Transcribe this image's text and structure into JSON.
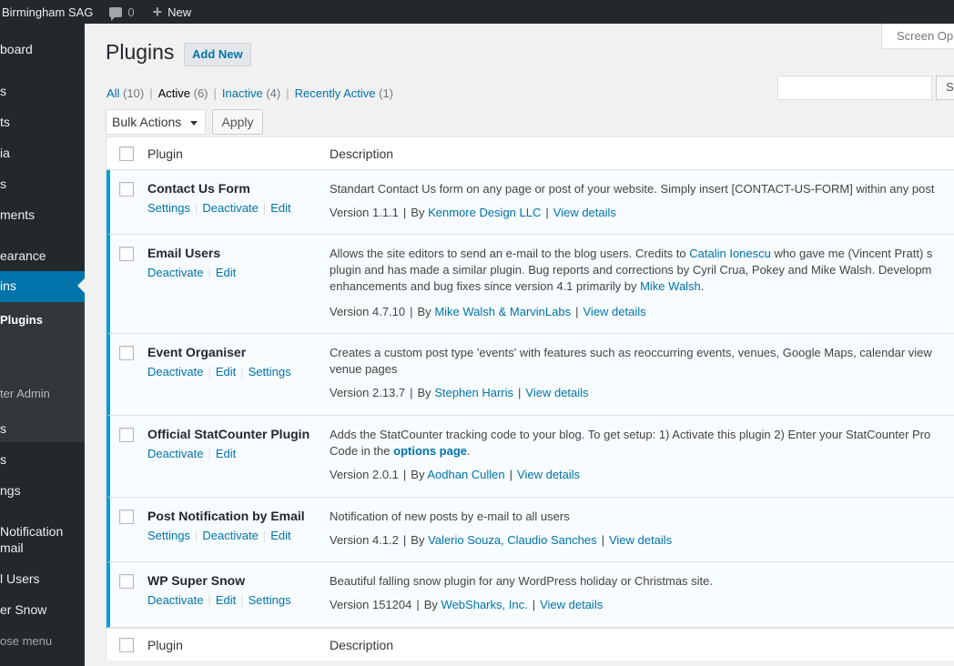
{
  "admin_bar": {
    "site_name": "Birmingham SAG",
    "comments_count": "0",
    "new_label": "New"
  },
  "sidebar": {
    "items": [
      {
        "label": "board"
      },
      {
        "label": "s"
      },
      {
        "label": "ts"
      },
      {
        "label": "ia"
      },
      {
        "label": "s"
      },
      {
        "label": "ments"
      },
      {
        "label": "earance"
      },
      {
        "label": "ins"
      }
    ],
    "submenu": [
      {
        "label": "Plugins"
      },
      {
        "label": "ter Admin"
      }
    ],
    "items_after": [
      {
        "label": "s"
      },
      {
        "label": "s"
      },
      {
        "label": "ngs"
      },
      {
        "label": "Notification"
      },
      {
        "label": "mail"
      },
      {
        "label": "l Users"
      },
      {
        "label": "er Snow"
      }
    ],
    "collapse_label": "ose menu"
  },
  "screen_options_label": "Screen Op",
  "page": {
    "title": "Plugins",
    "add_new_label": "Add New"
  },
  "filters": {
    "all": {
      "label": "All",
      "count": "(10)"
    },
    "active": {
      "label": "Active",
      "count": "(6)"
    },
    "inactive": {
      "label": "Inactive",
      "count": "(4)"
    },
    "recently_active": {
      "label": "Recently Active",
      "count": "(1)"
    },
    "separator": "|"
  },
  "search": {
    "button_label": "Se"
  },
  "bulk": {
    "selected": "Bulk Actions",
    "apply_label": "Apply"
  },
  "table": {
    "col_plugin": "Plugin",
    "col_description": "Description"
  },
  "plugins": [
    {
      "name": "Contact Us Form",
      "actions": [
        "Settings",
        "Deactivate",
        "Edit"
      ],
      "desc_lines": [
        "Standart Contact Us form on any page or post of your website. Simply insert [CONTACT-US-FORM] within any post"
      ],
      "version": "Version 1.1.1",
      "by": "By",
      "author": "Kenmore Design LLC",
      "details": "View details"
    },
    {
      "name": "Email Users",
      "actions": [
        "Deactivate",
        "Edit"
      ],
      "desc_line1_pre": "Allows the site editors to send an e-mail to the blog users. Credits to",
      "desc_line1_link": "Catalin Ionescu",
      "desc_line1_post": "who gave me (Vincent Pratt) s",
      "desc_line2": "plugin and has made a similar plugin. Bug reports and corrections by Cyril Crua, Pokey and Mike Walsh. Developm",
      "desc_line3_pre": "enhancements and bug fixes since version 4.1 primarily by",
      "desc_line3_link": "Mike Walsh",
      "desc_line3_post": ".",
      "version": "Version 4.7.10",
      "by": "By",
      "author": "Mike Walsh & MarvinLabs",
      "details": "View details"
    },
    {
      "name": "Event Organiser",
      "actions": [
        "Deactivate",
        "Edit",
        "Settings"
      ],
      "desc_lines": [
        "Creates a custom post type 'events' with features such as reoccurring events, venues, Google Maps, calendar view",
        "venue pages"
      ],
      "version": "Version 2.13.7",
      "by": "By",
      "author": "Stephen Harris",
      "details": "View details"
    },
    {
      "name": "Official StatCounter Plugin",
      "actions": [
        "Deactivate",
        "Edit"
      ],
      "desc_line1": "Adds the StatCounter tracking code to your blog. To get setup: 1) Activate this plugin 2) Enter your StatCounter Pro",
      "desc_line2_pre": "Code in the",
      "desc_line2_link": "options page",
      "desc_line2_post": ".",
      "version": "Version 2.0.1",
      "by": "By",
      "author": "Aodhan Cullen",
      "details": "View details"
    },
    {
      "name": "Post Notification by Email",
      "actions": [
        "Settings",
        "Deactivate",
        "Edit"
      ],
      "desc_lines": [
        "Notification of new posts by e-mail to all users"
      ],
      "version": "Version 4.1.2",
      "by": "By",
      "author": "Valerio Souza, Claudio Sanches",
      "details": "View details"
    },
    {
      "name": "WP Super Snow",
      "actions": [
        "Deactivate",
        "Edit",
        "Settings"
      ],
      "desc_lines": [
        "Beautiful falling snow plugin for any WordPress holiday or Christmas site."
      ],
      "version": "Version 151204",
      "by": "By",
      "author": "WebSharks, Inc.",
      "details": "View details"
    }
  ],
  "colors": {
    "admin_bar_bg": "#23282d",
    "accent": "#0073aa",
    "active_border": "#00a0d2"
  }
}
